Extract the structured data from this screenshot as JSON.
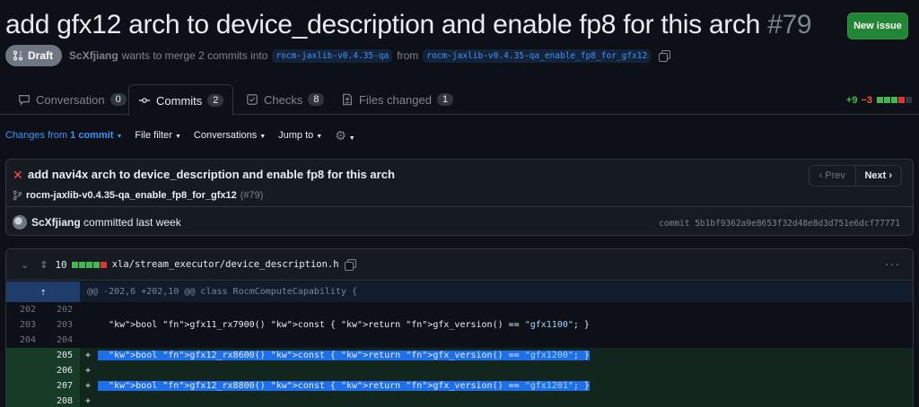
{
  "header": {
    "title": "add gfx12 arch to device_description and enable fp8 for this arch",
    "number": "#79",
    "new_issue_label": "New issue",
    "draft_label": "Draft",
    "author": "ScXfjiang",
    "merge_text": "wants to merge 2 commits into",
    "base_branch": "rocm-jaxlib-v0.4.35-qa",
    "from_text": "from",
    "head_branch": "rocm-jaxlib-v0.4.35-qa_enable_fp8_for_gfx12"
  },
  "tabs": [
    {
      "label": "Conversation",
      "count": "0",
      "icon": "comment-icon"
    },
    {
      "label": "Commits",
      "count": "2",
      "icon": "commit-icon"
    },
    {
      "label": "Checks",
      "count": "8",
      "icon": "checklist-icon"
    },
    {
      "label": "Files changed",
      "count": "1",
      "icon": "file-diff-icon"
    }
  ],
  "diffstat": {
    "additions": "+9",
    "deletions": "−3"
  },
  "toolbar": {
    "changes_prefix": "Changes from",
    "changes_value": "1 commit",
    "file_filter": "File filter",
    "conversations": "Conversations",
    "jump_to": "Jump to"
  },
  "commit": {
    "message": "add navi4x arch to device_description and enable fp8 for this arch",
    "branch": "rocm-jaxlib-v0.4.35-qa_enable_fp8_for_gfx12",
    "pr_ref": "(#79)",
    "prev_label": "Prev",
    "next_label": "Next",
    "committer": "ScXfjiang",
    "committed_text": "committed last week",
    "sha_label": "commit 5b1bf9362a9e8653f32d48e8d3d751e6dcf77771"
  },
  "file": {
    "changes": "10",
    "path": "xla/stream_executor/device_description.h",
    "hunk": "@@ -202,6 +202,10 @@ class RocmComputeCapability {",
    "lines": [
      {
        "old": "202",
        "new": "202",
        "type": "ctx",
        "text": ""
      },
      {
        "old": "203",
        "new": "203",
        "type": "ctx",
        "text": "  bool gfx11_rx7900() const { return gfx_version() == \"gfx1100\"; }"
      },
      {
        "old": "204",
        "new": "204",
        "type": "ctx",
        "text": ""
      },
      {
        "old": "",
        "new": "205",
        "type": "add",
        "text": "  bool gfx12_rx8600() const { return gfx_version() == \"gfx1200\"; }"
      },
      {
        "old": "",
        "new": "206",
        "type": "add",
        "text": ""
      },
      {
        "old": "",
        "new": "207",
        "type": "add",
        "text": "  bool gfx12_rx8800() const { return gfx_version() == \"gfx1201\"; }"
      },
      {
        "old": "",
        "new": "208",
        "type": "add",
        "text": ""
      }
    ]
  }
}
